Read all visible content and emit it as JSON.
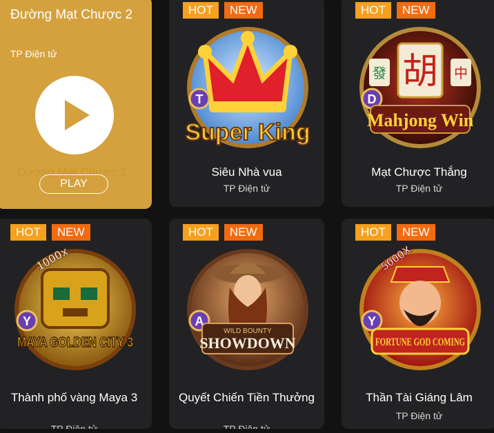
{
  "hover_card": {
    "title": "Đường Mạt Chược 2",
    "provider": "TP Điện tử",
    "ghost_title": "Đường Mạt Chược 2",
    "play_label": "PLAY"
  },
  "badges": {
    "hot": "HOT",
    "new": "NEW"
  },
  "games": [
    {
      "name": "Siêu Nhà vua",
      "provider": "TP Điện tử",
      "tier": "T",
      "logo": "Super King"
    },
    {
      "name": "Mạt Chược Thắng",
      "provider": "TP Điện tử",
      "tier": "D",
      "logo": "Mahjong Win"
    },
    {
      "name": "Thành phố vàng Maya 3",
      "provider": "TP Điện tử",
      "tier": "Y",
      "logo": "MAYA GOLDEN CITY 3",
      "multiplier": "1000x"
    },
    {
      "name": "Quyết Chiến Tiền Thưởng",
      "provider": "TP Điện tử",
      "tier": "A",
      "logo": "SHOWDOWN",
      "logo_sub": "WILD BOUNTY"
    },
    {
      "name": "Thần Tài Giáng Lâm",
      "provider": "TP Điện tử",
      "tier": "Y",
      "logo": "FORTUNE GOD COMING",
      "multiplier": "5000X"
    }
  ],
  "colors": {
    "hot": "#f6a01e",
    "new": "#f26b10",
    "card": "#222224",
    "hover": "#d4a13e"
  }
}
